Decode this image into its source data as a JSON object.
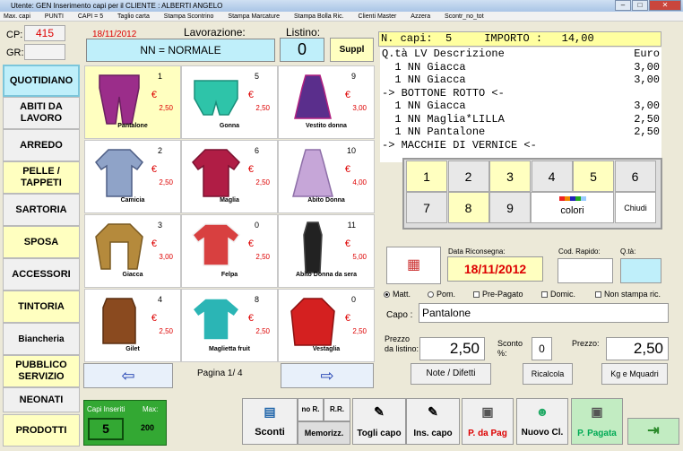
{
  "titlebar": {
    "text": "Utente: GEN     Inserimento capi per il CLIENTE : ALBERTI ANGELO"
  },
  "menu": [
    "Max. capi",
    "PUNTI",
    "CAPI = 5",
    "Taglio carta",
    "Stampa Scontrino",
    "Stampa Marcature",
    "Stampa Bolla Ric.",
    "Clienti Master",
    "Azzera",
    "Scontr_no_tot"
  ],
  "left": {
    "cp_label": "CP:",
    "cp_value": "415",
    "gr_label": "GR:",
    "gr_value": ""
  },
  "categories": [
    "QUOTIDIANO",
    "ABITI DA LAVORO",
    "ARREDO",
    "PELLE / TAPPETI",
    "SARTORIA",
    "SPOSA",
    "ACCESSORI",
    "TINTORIA",
    "Biancheria",
    "PUBBLICO SERVIZIO",
    "NEONATI",
    "PRODOTTI"
  ],
  "header": {
    "date": "18/11/2012",
    "lavorazione_label": "Lavorazione:",
    "lavorazione_value": "NN = NORMALE",
    "listino_label": "Listino:",
    "listino_value": "0",
    "suppl_label": "Suppl"
  },
  "items": [
    {
      "num": "1",
      "eur": "€",
      "price": "2,50",
      "name": "Pantalone"
    },
    {
      "num": "5",
      "eur": "€",
      "price": "2,50",
      "name": "Gonna"
    },
    {
      "num": "9",
      "eur": "€",
      "price": "3,00",
      "name": "Vestito donna"
    },
    {
      "num": "2",
      "eur": "€",
      "price": "2,50",
      "name": "Camicia"
    },
    {
      "num": "6",
      "eur": "€",
      "price": "2,50",
      "name": "Maglia"
    },
    {
      "num": "10",
      "eur": "€",
      "price": "4,00",
      "name": "Abito Donna"
    },
    {
      "num": "3",
      "eur": "€",
      "price": "3,00",
      "name": "Giacca"
    },
    {
      "num": "0",
      "eur": "€",
      "price": "2,50",
      "name": "Felpa"
    },
    {
      "num": "11",
      "eur": "€",
      "price": "5,00",
      "name": "Abito Donna da sera"
    },
    {
      "num": "4",
      "eur": "€",
      "price": "2,50",
      "name": "Gilet"
    },
    {
      "num": "8",
      "eur": "€",
      "price": "2,50",
      "name": "Maglietta fruit"
    },
    {
      "num": "0",
      "eur": "€",
      "price": "2,50",
      "name": "Vestaglia"
    }
  ],
  "pager": {
    "label": "Pagina  1/ 4"
  },
  "summary": {
    "capi_label": "N. capi:",
    "capi_value": "5",
    "importo_label": "IMPORTO :",
    "importo_value": "14,00"
  },
  "receipt": [
    {
      "t": "Q.tà LV Descrizione",
      "p": "Euro"
    },
    {
      "t": "  1 NN Giacca",
      "p": "3,00"
    },
    {
      "t": "  1 NN Giacca",
      "p": "3,00"
    },
    {
      "t": "-> BOTTONE ROTTO <-",
      "p": ""
    },
    {
      "t": "  1 NN Giacca",
      "p": "3,00"
    },
    {
      "t": "  1 NN Maglia*LILLA",
      "p": "2,50"
    },
    {
      "t": "  1 NN Pantalone",
      "p": "2,50"
    },
    {
      "t": "-> MACCHIE DI VERNICE <-",
      "p": ""
    }
  ],
  "keypad": {
    "keys": [
      "1",
      "2",
      "3",
      "4",
      "5",
      "6",
      "7",
      "8",
      "9"
    ],
    "colori": "colori",
    "chiudi": "Chiudi"
  },
  "form": {
    "data_label": "Data Riconsegna:",
    "data_value": "18/11/2012",
    "cod_label": "Cod. Rapido:",
    "qta_label": "Q.tà:",
    "radios": [
      "Matt.",
      "Pom.",
      "Pre-Pagato",
      "Domic.",
      "Non stampa ric."
    ],
    "capo_label": "Capo :",
    "capo_value": "Pantalone",
    "prezzo_listino_label": "Prezzo da listino:",
    "prezzo_listino_value": "2,50",
    "sconto_label": "Sconto %:",
    "sconto_value": "0",
    "prezzo_label": "Prezzo:",
    "prezzo_value": "2,50",
    "note_label": "Note / Difetti",
    "ricalcola_label": "Ricalcola",
    "kg_label": "Kg e Mquadri"
  },
  "capi": {
    "label": "Capi Inseriti",
    "max_label": "Max:",
    "value": "5",
    "max_value": "200"
  },
  "bottom": {
    "sconti": "Sconti",
    "nor": "no R.",
    "rr": "R.R.",
    "memorizz": "Memorizz.",
    "togli": "Togli capo",
    "ins": "Ins. capo",
    "pdapag": "P. da Pag",
    "nuovo": "Nuovo Cl.",
    "pagata": "P. Pagata"
  },
  "colors": {
    "yellow": "#ffffc0",
    "cyan": "#bfeffa",
    "green": "#33a833",
    "red": "#dd0000"
  }
}
